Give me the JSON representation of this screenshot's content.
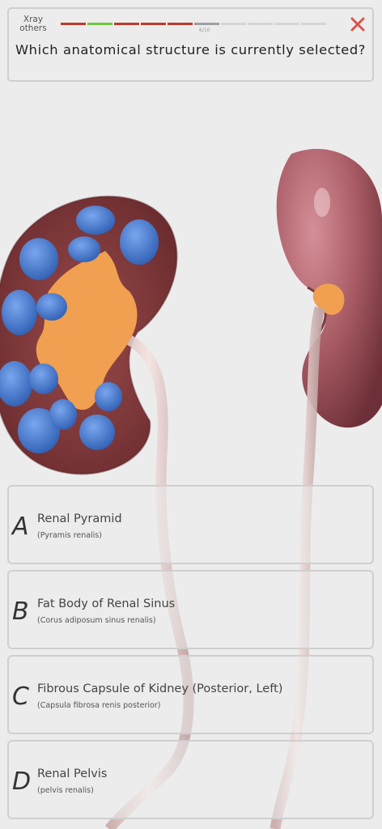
{
  "header": {
    "category": "Xray others",
    "progress_text": "6/10",
    "progress": {
      "total": 10,
      "segment_colors": [
        "#c0392b",
        "#6dc93f",
        "#c0392b",
        "#c0392b",
        "#c0392b",
        "#9aa0a6",
        "#d4d4d4",
        "#d4d4d4",
        "#d4d4d4",
        "#d4d4d4"
      ]
    },
    "close_icon": "close-x-icon",
    "question": "Which anatomical structure is currently selected?"
  },
  "answers": [
    {
      "letter": "A",
      "name": "Renal Pyramid",
      "latin": "(Pyramis renalis)"
    },
    {
      "letter": "B",
      "name": "Fat Body of Renal Sinus",
      "latin": "(Corus adiposum sinus renalis)"
    },
    {
      "letter": "C",
      "name": "Fibrous Capsule of Kidney (Posterior, Left)",
      "latin": "(Capsula fibrosa renis  posterior)"
    },
    {
      "letter": "D",
      "name": "Renal Pelvis",
      "latin": "(pelvis renalis)"
    }
  ],
  "colors": {
    "background": "#ececec",
    "close": "#d9534f",
    "pyramid_selected": "#4a7fd6",
    "renal_sinus_fat": "#f0a050",
    "kidney": "#a85a62",
    "ureter": "#e8c9c6"
  }
}
